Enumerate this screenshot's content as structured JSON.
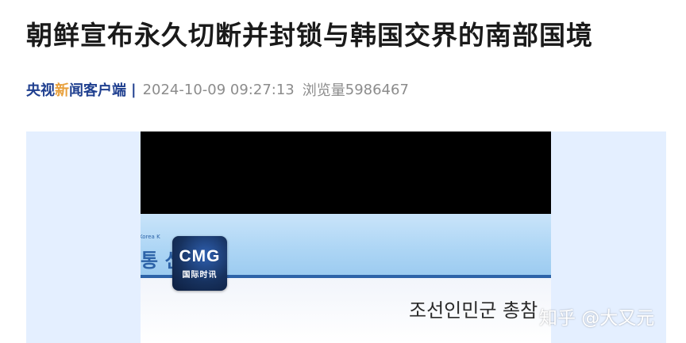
{
  "article": {
    "headline": "朝鲜宣布永久切断并封锁与韩国交界的南部国境",
    "source": {
      "brand_part1": "央视",
      "brand_accent": "新",
      "brand_part2": "闻客户端",
      "separator": "|"
    },
    "datetime": "2024-10-09 09:27:13",
    "views_label": "浏览量",
    "views_count": "5986467"
  },
  "media": {
    "video_text": {
      "kcna_small": "Korea K",
      "kcna_big": "통 신",
      "korean_title": "조선인민군 총참"
    },
    "channel_logo": {
      "mark": "CMG",
      "subtitle": "国际时讯"
    },
    "watermark": "知乎 @大又元"
  },
  "colors": {
    "brand_blue": "#1f3f8f",
    "brand_accent": "#e8a03c",
    "meta_gray": "#8c8c8c",
    "frame_bg": "#e4efff"
  }
}
